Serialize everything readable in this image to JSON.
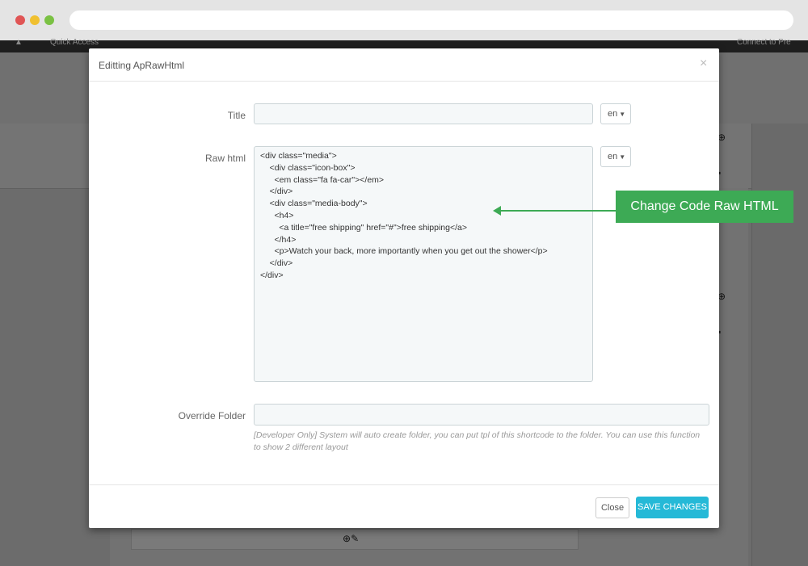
{
  "background": {
    "topbar_left": "Quick Access",
    "topbar_right": "Connect to Pre"
  },
  "modal": {
    "title": "Editting ApRawHtml",
    "close_glyph": "×",
    "fields": {
      "title_label": "Title",
      "title_value": "",
      "title_lang": "en",
      "raw_label": "Raw html",
      "raw_lang": "en",
      "raw_lines": [
        "<div class=\"media\">",
        "    <div class=\"icon-box\">",
        "      <em class=\"fa fa-car\"></em>",
        "    </div>",
        "    <div class=\"media-body\">",
        "      <h4>",
        "        <a title=\"free shipping\" href=\"#\">free shipping</a>",
        "      </h4>",
        "      <p>Watch your back, more importantly when you get out the shower</p>",
        "    </div>",
        "</div>"
      ],
      "override_label": "Override Folder",
      "override_value": "",
      "override_help": "[Developer Only] System will auto create folder, you can put tpl of this shortcode to the folder. You can use this function to show 2 different layout"
    },
    "footer": {
      "close_label": "Close",
      "save_label": "SAVE CHANGES"
    }
  },
  "annotation": {
    "text": "Change Code Raw HTML"
  },
  "colors": {
    "accent": "#25b9d7",
    "annotation": "#3daa55"
  }
}
